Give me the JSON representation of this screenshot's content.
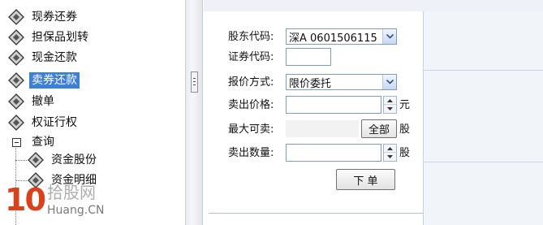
{
  "tree": {
    "items": [
      {
        "label": "现券还券",
        "icon": "diamond-node-icon"
      },
      {
        "label": "担保品划转",
        "icon": "diamond-node-icon"
      },
      {
        "label": "现金还款",
        "icon": "diamond-node-icon"
      },
      {
        "label": "卖券还款",
        "icon": "diamond-node-icon",
        "selected": true
      },
      {
        "label": "撤单",
        "icon": "diamond-node-icon"
      },
      {
        "label": "权证行权",
        "icon": "diamond-node-icon"
      },
      {
        "label": "查询",
        "icon": "collapse-box-icon"
      },
      {
        "label": "资金股份",
        "icon": "diamond-node-icon"
      },
      {
        "label": "资金明细",
        "icon": "diamond-node-icon"
      }
    ],
    "selected_color": "#3b7fd6"
  },
  "form": {
    "shareholder_code_label": "股东代码:",
    "shareholder_code_value": "深A 0601506115",
    "security_code_label": "证券代码:",
    "security_code_value": "",
    "quote_method_label": "报价方式:",
    "quote_method_value": "限价委托",
    "sell_price_label": "卖出价格:",
    "sell_price_value": "",
    "price_unit": "元",
    "max_sellable_label": "最大可卖:",
    "max_sellable_value": "",
    "all_button": "全部",
    "max_unit": "股",
    "sell_qty_label": "卖出数量:",
    "sell_qty_value": "",
    "qty_unit": "股",
    "submit_button": "下 单"
  },
  "watermark": {
    "number": "10",
    "site_cn": "拾股网",
    "site_domain": "Huang.CN",
    "number_color": "#d9421c"
  }
}
